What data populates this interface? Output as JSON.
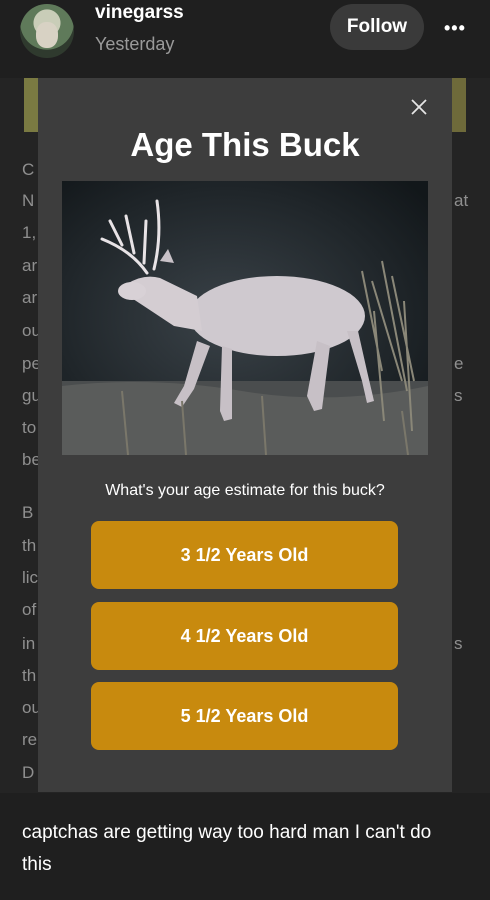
{
  "post": {
    "username": "vinegarss",
    "timestamp": "Yesterday",
    "follow_label": "Follow",
    "more_label": "•••",
    "caption": "captchas are getting way too hard man I can't do this"
  },
  "article_fragments": {
    "left": [
      "C",
      "N",
      "1,",
      "ar",
      "ar",
      "ou",
      "pe",
      "gu",
      "to",
      "be",
      "B",
      "th",
      "lic",
      "of",
      "in",
      "th",
      "ou",
      "re",
      "D"
    ],
    "right": [
      "at",
      "e",
      "s",
      "s"
    ]
  },
  "modal": {
    "title": "Age This Buck",
    "question": "What's your age estimate for this buck?",
    "options": [
      "3 1/2 Years Old",
      "4 1/2 Years Old",
      "5 1/2 Years Old"
    ],
    "close_icon": "close-icon",
    "accent_color": "#c88a0e"
  }
}
